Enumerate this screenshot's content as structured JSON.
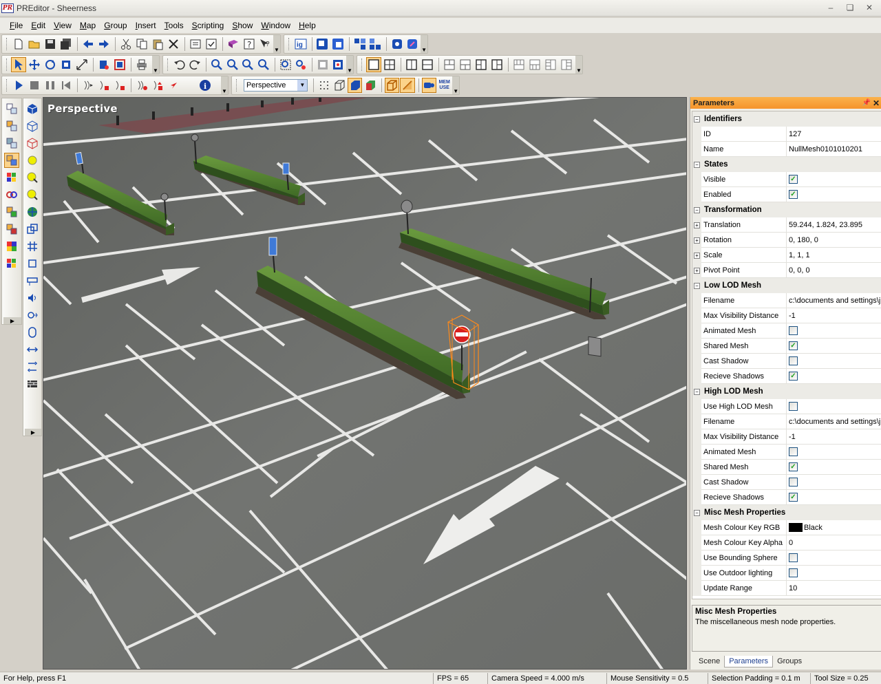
{
  "window": {
    "app_icon_text": "PR",
    "title": "PREditor - Sheerness"
  },
  "menu": [
    "File",
    "Edit",
    "View",
    "Map",
    "Group",
    "Insert",
    "Tools",
    "Scripting",
    "Show",
    "Window",
    "Help"
  ],
  "toolbar": {
    "view_select": "Perspective",
    "mem_use_label": "MEM USE"
  },
  "viewport": {
    "label": "Perspective"
  },
  "panel": {
    "title": "Parameters",
    "categories": [
      {
        "name": "Identifiers",
        "rows": [
          {
            "name": "ID",
            "value": "127"
          },
          {
            "name": "Name",
            "value": "NullMesh0101010201"
          }
        ]
      },
      {
        "name": "States",
        "rows": [
          {
            "name": "Visible",
            "check": true
          },
          {
            "name": "Enabled",
            "check": true
          }
        ]
      },
      {
        "name": "Transformation",
        "rows": [
          {
            "name": "Translation",
            "value": "59.244, 1.824, 23.895",
            "expandable": true
          },
          {
            "name": "Rotation",
            "value": "0, 180, 0",
            "expandable": true
          },
          {
            "name": "Scale",
            "value": "1, 1, 1",
            "expandable": true
          },
          {
            "name": "Pivot Point",
            "value": "0, 0, 0",
            "expandable": true
          }
        ]
      },
      {
        "name": "Low LOD Mesh",
        "rows": [
          {
            "name": "Filename",
            "value": "c:\\documents and settings\\j"
          },
          {
            "name": "Max Visibility Distance",
            "value": "-1"
          },
          {
            "name": "Animated Mesh",
            "check": false
          },
          {
            "name": "Shared Mesh",
            "check": true
          },
          {
            "name": "Cast Shadow",
            "check": false
          },
          {
            "name": "Recieve Shadows",
            "check": true
          }
        ]
      },
      {
        "name": "High LOD Mesh",
        "rows": [
          {
            "name": "Use High LOD Mesh",
            "check": false
          },
          {
            "name": "Filename",
            "value": "c:\\documents and settings\\j"
          },
          {
            "name": "Max Visibility Distance",
            "value": "-1"
          },
          {
            "name": "Animated Mesh",
            "check": false
          },
          {
            "name": "Shared Mesh",
            "check": true
          },
          {
            "name": "Cast Shadow",
            "check": false
          },
          {
            "name": "Recieve Shadows",
            "check": true
          }
        ]
      },
      {
        "name": "Misc Mesh Properties",
        "rows": [
          {
            "name": "Mesh Colour Key RGB",
            "value": "Black",
            "swatch": "#000000"
          },
          {
            "name": "Mesh Colour Key Alpha",
            "value": "0"
          },
          {
            "name": "Use Bounding Sphere",
            "check": false
          },
          {
            "name": "Use Outdoor lighting",
            "check": false
          },
          {
            "name": "Update Range",
            "value": "10"
          }
        ]
      }
    ],
    "description": {
      "title": "Misc Mesh Properties",
      "text": "The miscellaneous mesh node properties."
    },
    "tabs": [
      "Scene",
      "Parameters",
      "Groups"
    ],
    "active_tab": "Parameters"
  },
  "status": {
    "help": "For Help, press F1",
    "fps": "FPS = 65",
    "camera_speed": "Camera Speed = 4.000 m/s",
    "mouse_sensitivity": "Mouse Sensitivity = 0.5",
    "selection_padding": "Selection Padding = 0.1 m",
    "tool_size": "Tool Size = 0.25"
  },
  "colors": {
    "accent": "#f5942b",
    "selection": "#ff8a1a",
    "asphalt": "#6c6e6b",
    "hedge": "#4f7a2e"
  }
}
